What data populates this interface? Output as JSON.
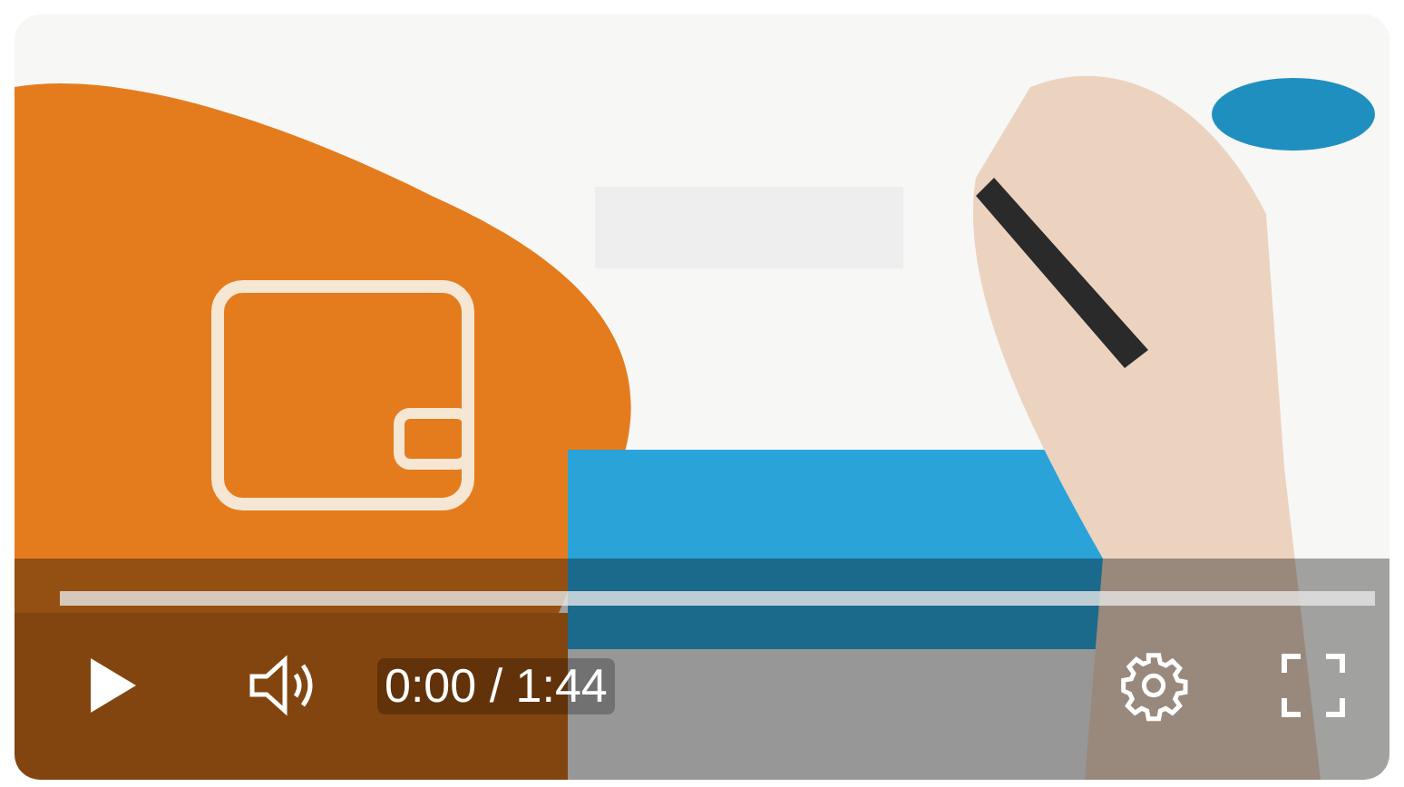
{
  "player": {
    "playing": false,
    "progress": {
      "level": 0
    },
    "time": "0:00 / 1:44"
  }
}
